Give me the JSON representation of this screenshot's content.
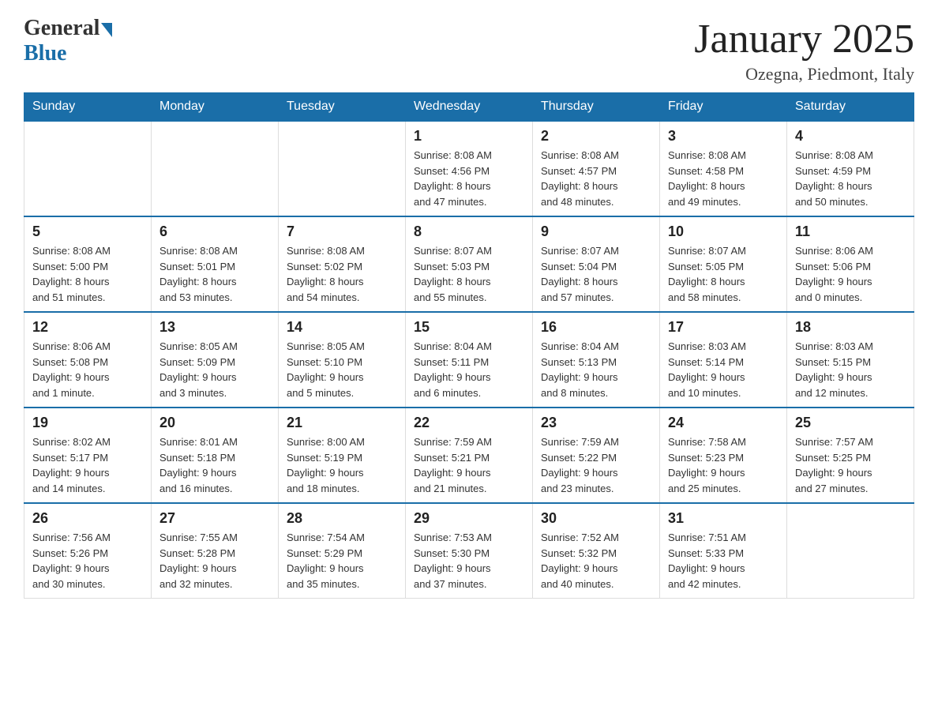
{
  "logo": {
    "general": "General",
    "blue": "Blue"
  },
  "title": "January 2025",
  "location": "Ozegna, Piedmont, Italy",
  "days_of_week": [
    "Sunday",
    "Monday",
    "Tuesday",
    "Wednesday",
    "Thursday",
    "Friday",
    "Saturday"
  ],
  "weeks": [
    [
      {
        "day": "",
        "info": ""
      },
      {
        "day": "",
        "info": ""
      },
      {
        "day": "",
        "info": ""
      },
      {
        "day": "1",
        "info": "Sunrise: 8:08 AM\nSunset: 4:56 PM\nDaylight: 8 hours\nand 47 minutes."
      },
      {
        "day": "2",
        "info": "Sunrise: 8:08 AM\nSunset: 4:57 PM\nDaylight: 8 hours\nand 48 minutes."
      },
      {
        "day": "3",
        "info": "Sunrise: 8:08 AM\nSunset: 4:58 PM\nDaylight: 8 hours\nand 49 minutes."
      },
      {
        "day": "4",
        "info": "Sunrise: 8:08 AM\nSunset: 4:59 PM\nDaylight: 8 hours\nand 50 minutes."
      }
    ],
    [
      {
        "day": "5",
        "info": "Sunrise: 8:08 AM\nSunset: 5:00 PM\nDaylight: 8 hours\nand 51 minutes."
      },
      {
        "day": "6",
        "info": "Sunrise: 8:08 AM\nSunset: 5:01 PM\nDaylight: 8 hours\nand 53 minutes."
      },
      {
        "day": "7",
        "info": "Sunrise: 8:08 AM\nSunset: 5:02 PM\nDaylight: 8 hours\nand 54 minutes."
      },
      {
        "day": "8",
        "info": "Sunrise: 8:07 AM\nSunset: 5:03 PM\nDaylight: 8 hours\nand 55 minutes."
      },
      {
        "day": "9",
        "info": "Sunrise: 8:07 AM\nSunset: 5:04 PM\nDaylight: 8 hours\nand 57 minutes."
      },
      {
        "day": "10",
        "info": "Sunrise: 8:07 AM\nSunset: 5:05 PM\nDaylight: 8 hours\nand 58 minutes."
      },
      {
        "day": "11",
        "info": "Sunrise: 8:06 AM\nSunset: 5:06 PM\nDaylight: 9 hours\nand 0 minutes."
      }
    ],
    [
      {
        "day": "12",
        "info": "Sunrise: 8:06 AM\nSunset: 5:08 PM\nDaylight: 9 hours\nand 1 minute."
      },
      {
        "day": "13",
        "info": "Sunrise: 8:05 AM\nSunset: 5:09 PM\nDaylight: 9 hours\nand 3 minutes."
      },
      {
        "day": "14",
        "info": "Sunrise: 8:05 AM\nSunset: 5:10 PM\nDaylight: 9 hours\nand 5 minutes."
      },
      {
        "day": "15",
        "info": "Sunrise: 8:04 AM\nSunset: 5:11 PM\nDaylight: 9 hours\nand 6 minutes."
      },
      {
        "day": "16",
        "info": "Sunrise: 8:04 AM\nSunset: 5:13 PM\nDaylight: 9 hours\nand 8 minutes."
      },
      {
        "day": "17",
        "info": "Sunrise: 8:03 AM\nSunset: 5:14 PM\nDaylight: 9 hours\nand 10 minutes."
      },
      {
        "day": "18",
        "info": "Sunrise: 8:03 AM\nSunset: 5:15 PM\nDaylight: 9 hours\nand 12 minutes."
      }
    ],
    [
      {
        "day": "19",
        "info": "Sunrise: 8:02 AM\nSunset: 5:17 PM\nDaylight: 9 hours\nand 14 minutes."
      },
      {
        "day": "20",
        "info": "Sunrise: 8:01 AM\nSunset: 5:18 PM\nDaylight: 9 hours\nand 16 minutes."
      },
      {
        "day": "21",
        "info": "Sunrise: 8:00 AM\nSunset: 5:19 PM\nDaylight: 9 hours\nand 18 minutes."
      },
      {
        "day": "22",
        "info": "Sunrise: 7:59 AM\nSunset: 5:21 PM\nDaylight: 9 hours\nand 21 minutes."
      },
      {
        "day": "23",
        "info": "Sunrise: 7:59 AM\nSunset: 5:22 PM\nDaylight: 9 hours\nand 23 minutes."
      },
      {
        "day": "24",
        "info": "Sunrise: 7:58 AM\nSunset: 5:23 PM\nDaylight: 9 hours\nand 25 minutes."
      },
      {
        "day": "25",
        "info": "Sunrise: 7:57 AM\nSunset: 5:25 PM\nDaylight: 9 hours\nand 27 minutes."
      }
    ],
    [
      {
        "day": "26",
        "info": "Sunrise: 7:56 AM\nSunset: 5:26 PM\nDaylight: 9 hours\nand 30 minutes."
      },
      {
        "day": "27",
        "info": "Sunrise: 7:55 AM\nSunset: 5:28 PM\nDaylight: 9 hours\nand 32 minutes."
      },
      {
        "day": "28",
        "info": "Sunrise: 7:54 AM\nSunset: 5:29 PM\nDaylight: 9 hours\nand 35 minutes."
      },
      {
        "day": "29",
        "info": "Sunrise: 7:53 AM\nSunset: 5:30 PM\nDaylight: 9 hours\nand 37 minutes."
      },
      {
        "day": "30",
        "info": "Sunrise: 7:52 AM\nSunset: 5:32 PM\nDaylight: 9 hours\nand 40 minutes."
      },
      {
        "day": "31",
        "info": "Sunrise: 7:51 AM\nSunset: 5:33 PM\nDaylight: 9 hours\nand 42 minutes."
      },
      {
        "day": "",
        "info": ""
      }
    ]
  ]
}
